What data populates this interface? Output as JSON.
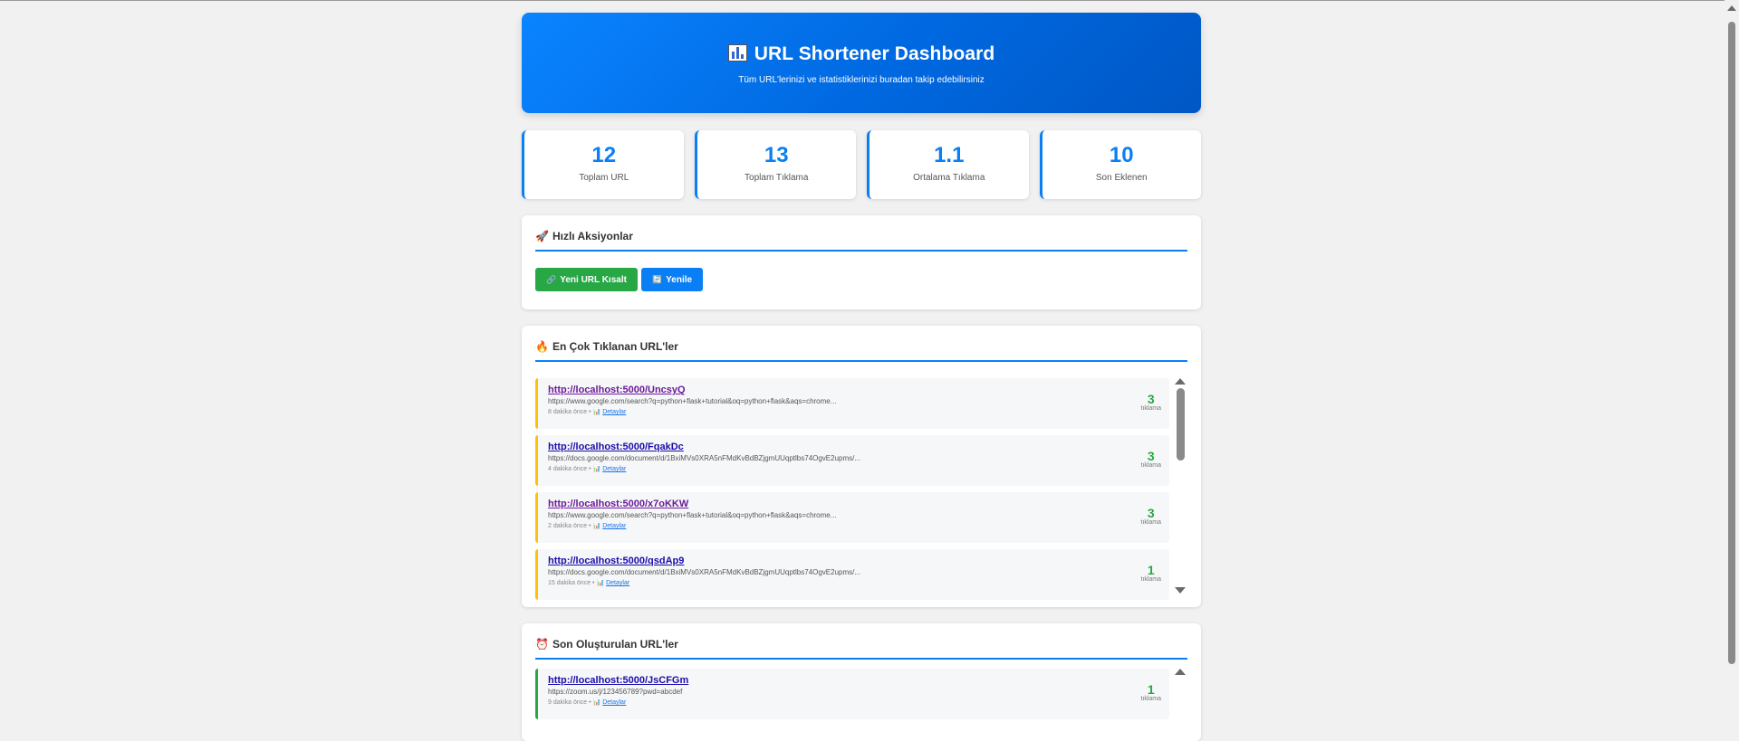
{
  "header": {
    "title": "URL Shortener Dashboard",
    "subtitle": "Tüm URL'lerinizi ve istatistiklerinizi buradan takip edebilirsiniz"
  },
  "stats": [
    {
      "value": "12",
      "label": "Toplam URL"
    },
    {
      "value": "13",
      "label": "Toplam Tıklama"
    },
    {
      "value": "1.1",
      "label": "Ortalama Tıklama"
    },
    {
      "value": "10",
      "label": "Son Eklenen"
    }
  ],
  "quick_actions": {
    "emoji": "🚀",
    "title": "Hızlı Aksiyonlar",
    "new_url_label": "Yeni URL Kısalt",
    "new_url_icon": "🔗",
    "refresh_label": "Yenile",
    "refresh_icon": "🔄"
  },
  "top_clicked": {
    "emoji": "🔥",
    "title": "En Çok Tıklanan URL'ler",
    "items": [
      {
        "short": "http://localhost:5000/UncsyQ",
        "original": "https://www.google.com/search?q=python+flask+tutorial&oq=python+flask&aqs=chrome...",
        "time": "8 dakika önce",
        "details": "Detaylar",
        "clicks": "3",
        "clicks_label": "tıklama"
      },
      {
        "short": "http://localhost:5000/FqakDc",
        "original": "https://docs.google.com/document/d/1BxiMVs0XRA5nFMdKvBdBZjgmUUqptlbs74OgvE2upms/...",
        "time": "4 dakika önce",
        "details": "Detaylar",
        "clicks": "3",
        "clicks_label": "tıklama"
      },
      {
        "short": "http://localhost:5000/x7oKKW",
        "original": "https://www.google.com/search?q=python+flask+tutorial&oq=python+flask&aqs=chrome...",
        "time": "2 dakika önce",
        "details": "Detaylar",
        "clicks": "3",
        "clicks_label": "tıklama"
      },
      {
        "short": "http://localhost:5000/qsdAp9",
        "original": "https://docs.google.com/document/d/1BxiMVs0XRA5nFMdKvBdBZjgmUUqptlbs74OgvE2upms/...",
        "time": "15 dakika önce",
        "details": "Detaylar",
        "clicks": "1",
        "clicks_label": "tıklama"
      }
    ]
  },
  "recent": {
    "emoji": "⏰",
    "title": "Son Oluşturulan URL'ler",
    "items": [
      {
        "short": "http://localhost:5000/JsCFGm",
        "original": "https://zoom.us/j/123456789?pwd=abcdef",
        "time": "9 dakika önce",
        "details": "Detaylar",
        "clicks": "1",
        "clicks_label": "tıklama"
      }
    ]
  },
  "colors": {
    "primary": "#0a7ff5",
    "success": "#28a745",
    "warning": "#ffc107"
  }
}
